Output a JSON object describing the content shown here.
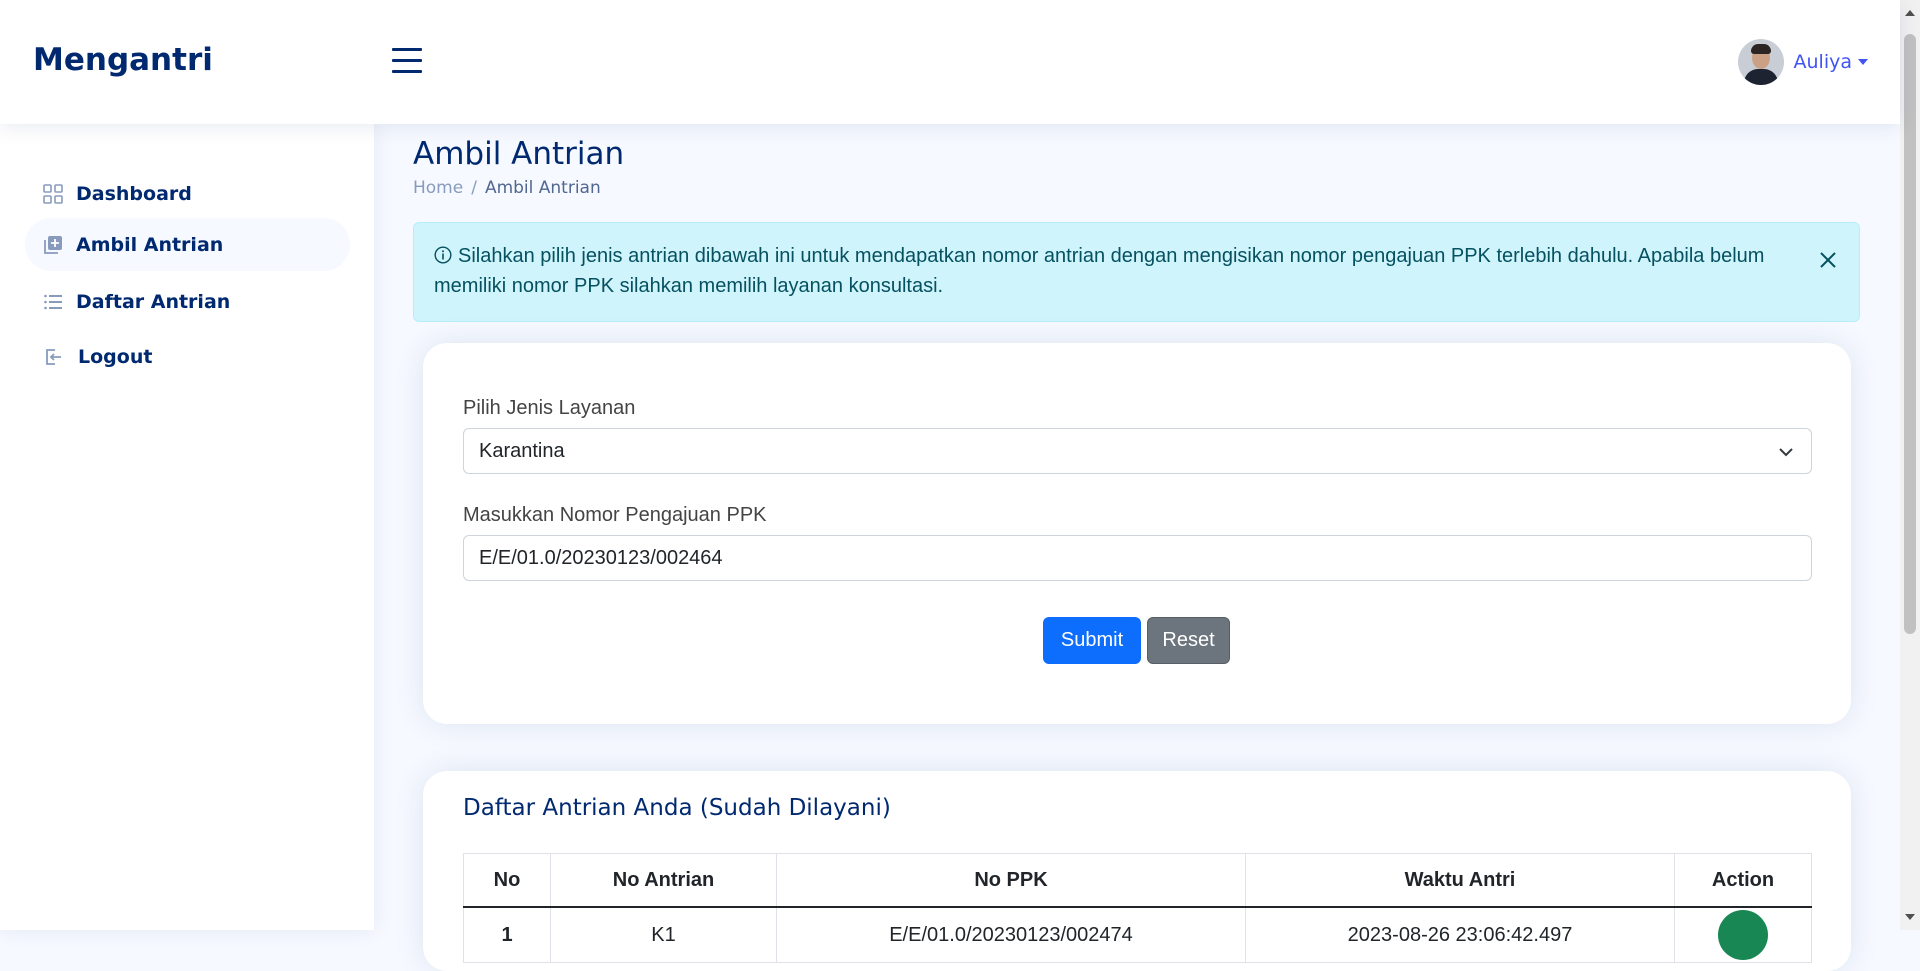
{
  "header": {
    "brand": "Mengantri",
    "user_name": "Auliya"
  },
  "sidebar": {
    "items": [
      {
        "label": "Dashboard",
        "icon": "grid-icon"
      },
      {
        "label": "Ambil Antrian",
        "icon": "add-queue-icon"
      },
      {
        "label": "Daftar Antrian",
        "icon": "list-icon"
      },
      {
        "label": "Logout",
        "icon": "logout-icon"
      }
    ]
  },
  "page": {
    "title": "Ambil Antrian",
    "breadcrumb": [
      "Home",
      "Ambil Antrian"
    ]
  },
  "alert": {
    "text": "Silahkan pilih jenis antrian dibawah ini untuk mendapatkan nomor antrian dengan mengisikan nomor pengajuan PPK terlebih dahulu. Apabila belum memiliki nomor PPK silahkan memilih layanan konsultasi."
  },
  "form": {
    "service_label": "Pilih Jenis Layanan",
    "service_value": "Karantina",
    "ppk_label": "Masukkan Nomor Pengajuan PPK",
    "ppk_value": "E/E/01.0/20230123/002464",
    "submit_label": "Submit",
    "reset_label": "Reset"
  },
  "table": {
    "title": "Daftar Antrian Anda (Sudah Dilayani)",
    "headers": [
      "No",
      "No Antrian",
      "No PPK",
      "Waktu Antri",
      "Action"
    ],
    "rows": [
      {
        "no": "1",
        "antrian": "K1",
        "ppk": "E/E/01.0/20230123/002474",
        "waktu": "2023-08-26 23:06:42.497"
      }
    ]
  },
  "colors": {
    "brand": "#012970",
    "accent": "#4154f1",
    "alert_bg": "#cff4fc",
    "primary": "#0d6efd",
    "secondary": "#6c757d",
    "success": "#198754"
  }
}
